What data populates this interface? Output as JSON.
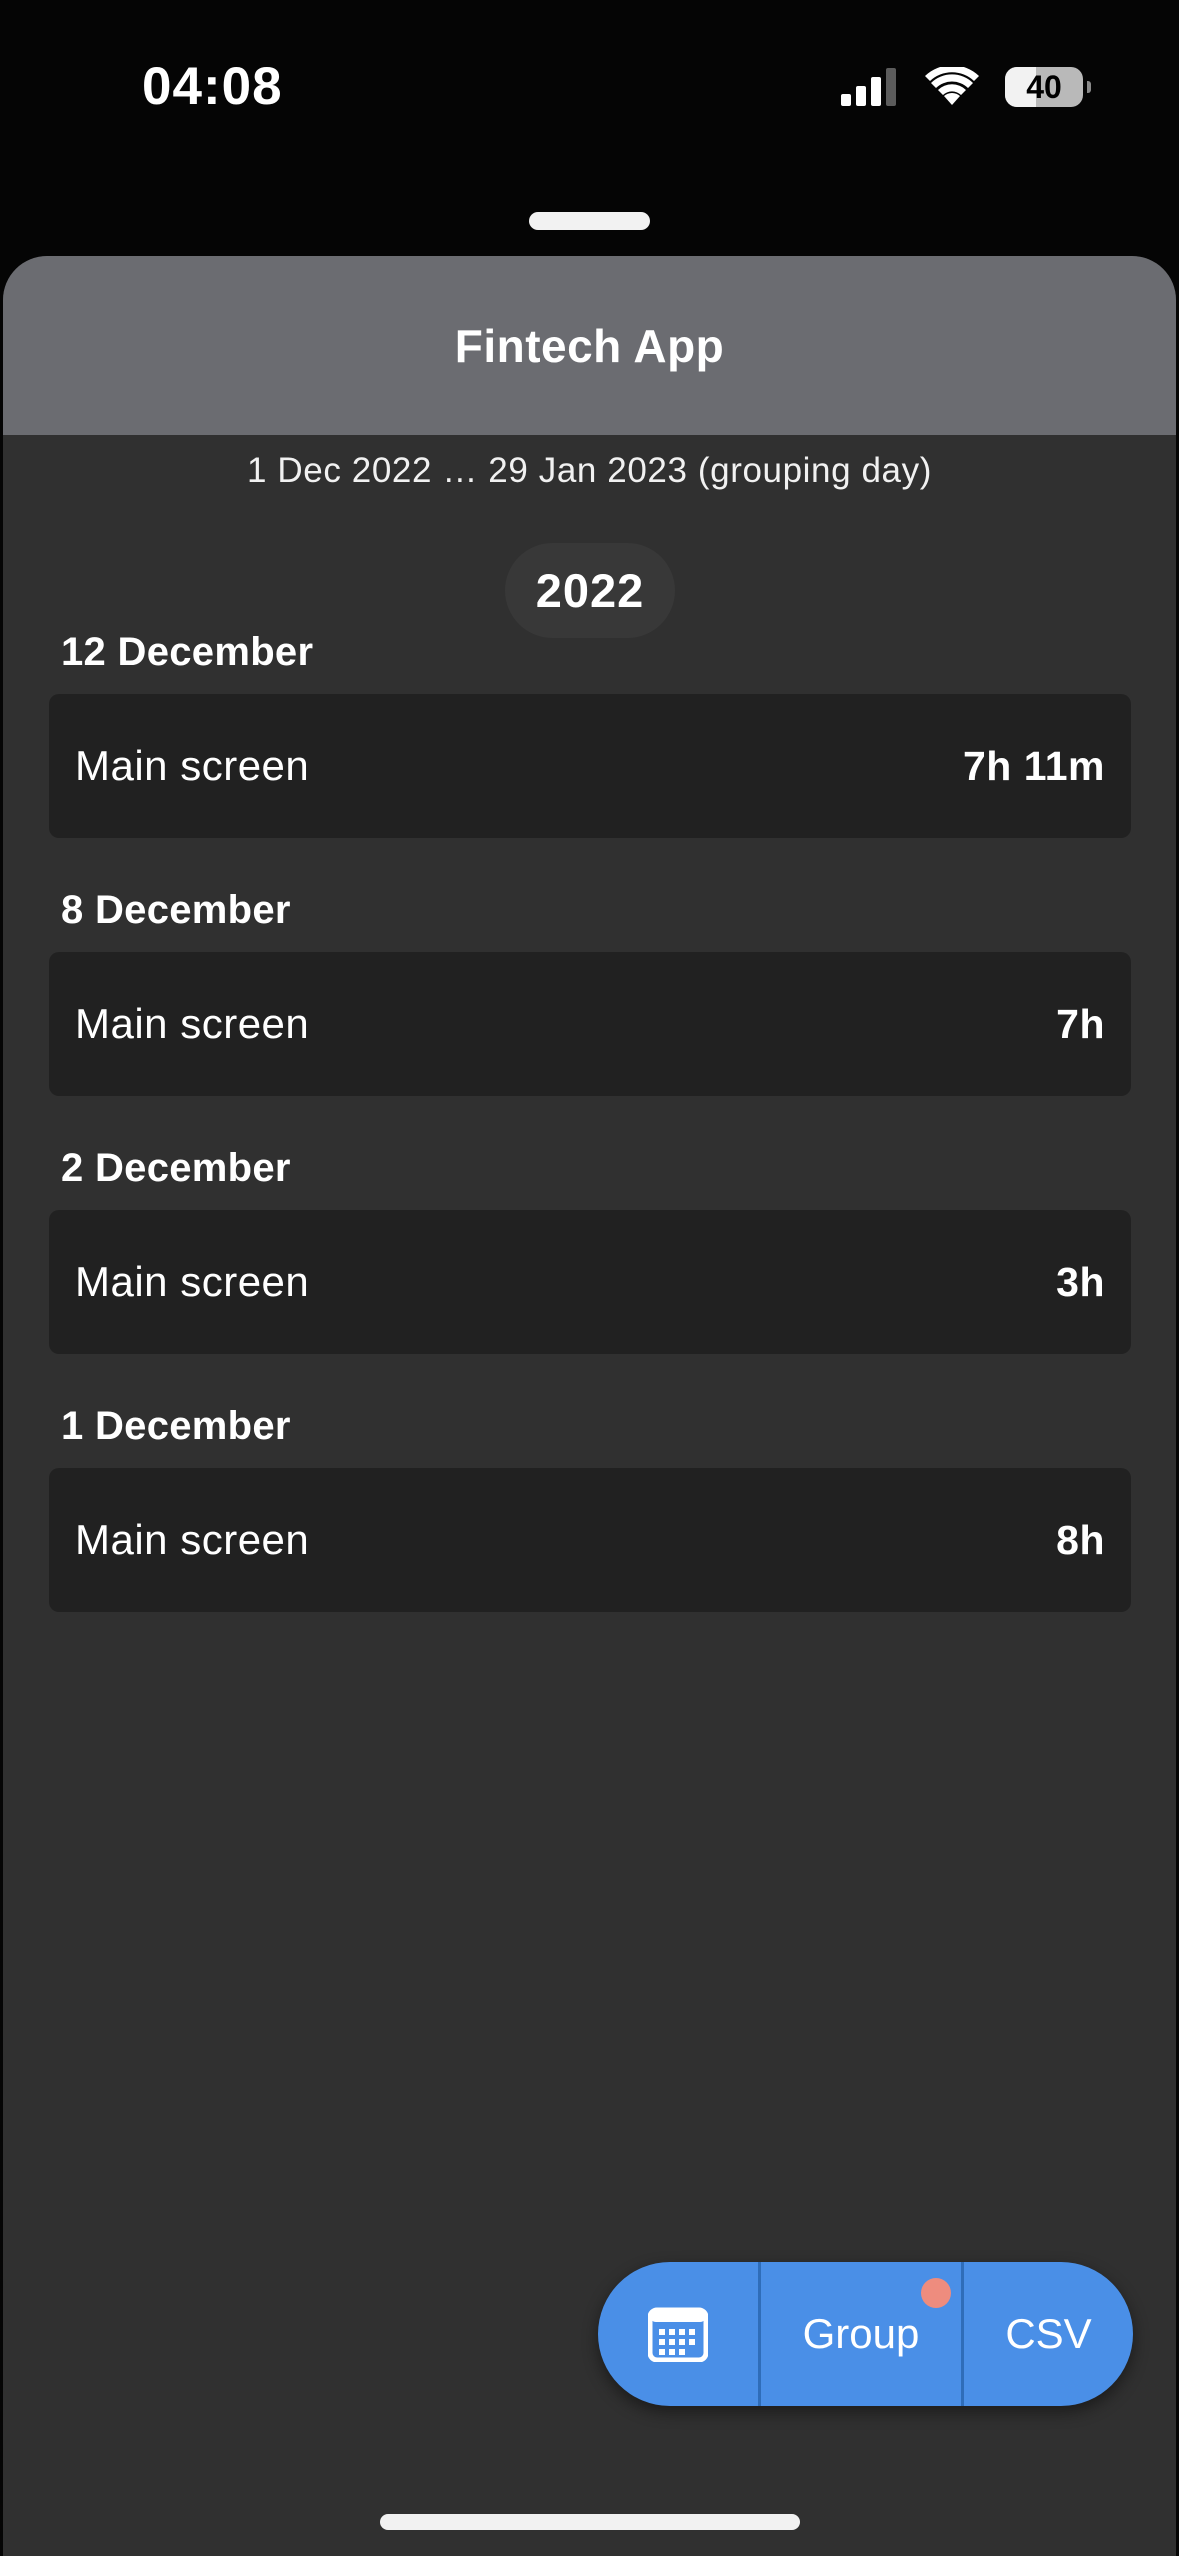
{
  "status_bar": {
    "time": "04:08",
    "battery_level": "40",
    "battery_fraction": 0.4,
    "icons": [
      "cellular-signal-icon",
      "wifi-icon",
      "battery-icon"
    ]
  },
  "app_bar": {
    "title": "Fintech App"
  },
  "filter": {
    "date_range": "1 Dec 2022 … 29 Jan 2023 (grouping day)"
  },
  "year_chip": "2022",
  "groups": [
    {
      "date": "12 December",
      "items": [
        {
          "label": "Main screen",
          "value": "7h 11m"
        }
      ]
    },
    {
      "date": "8 December",
      "items": [
        {
          "label": "Main screen",
          "value": "7h"
        }
      ]
    },
    {
      "date": "2 December",
      "items": [
        {
          "label": "Main screen",
          "value": "3h"
        }
      ]
    },
    {
      "date": "1 December",
      "items": [
        {
          "label": "Main screen",
          "value": "8h"
        }
      ]
    }
  ],
  "fab": {
    "calendar_icon": "calendar-icon",
    "group_label": "Group",
    "csv_label": "CSV",
    "badge_color": "#ee8c7e"
  },
  "colors": {
    "accent": "#4a8fe7",
    "app_bar": "#6b6c71",
    "background": "#303030",
    "row": "#212121"
  }
}
